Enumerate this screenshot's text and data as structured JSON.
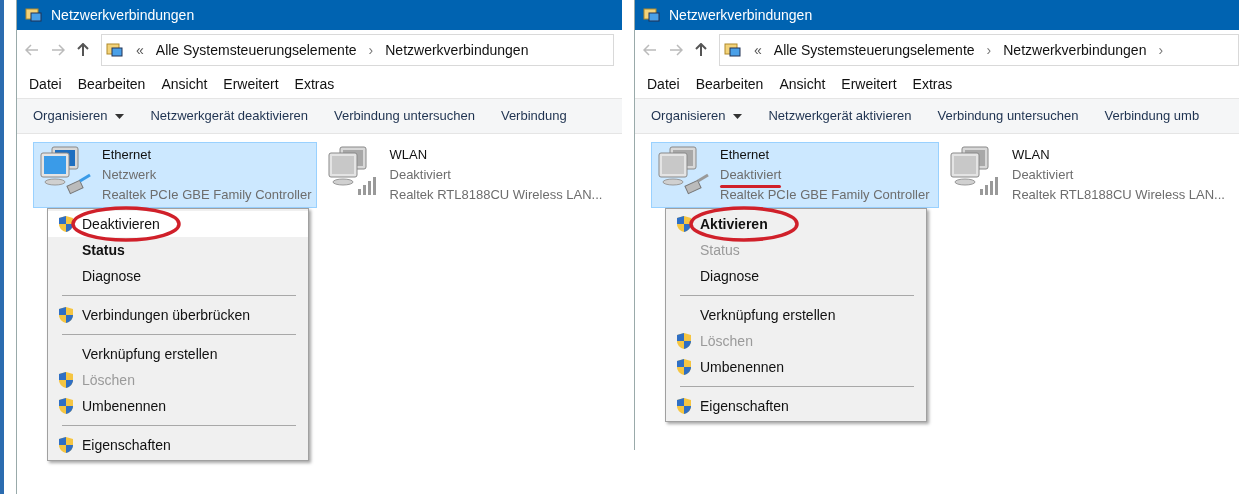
{
  "panels": [
    {
      "window": {
        "title": "Netzwerkverbindungen"
      },
      "address": {
        "back_mark": "«",
        "parts": [
          "Alle Systemsteuerungselemente",
          "Netzwerkverbindungen"
        ],
        "separator": "›",
        "trailing_separator": false
      },
      "menu_bar": [
        "Datei",
        "Bearbeiten",
        "Ansicht",
        "Erweitert",
        "Extras"
      ],
      "toolbar": [
        {
          "label": "Organisieren",
          "dropdown": true
        },
        {
          "label": "Netzwerkgerät deaktivieren",
          "dropdown": false
        },
        {
          "label": "Verbindung untersuchen",
          "dropdown": false
        },
        {
          "label": "Verbindung",
          "dropdown": false
        }
      ],
      "connections": [
        {
          "kind": "wired",
          "name": "Ethernet",
          "status": "Netzwerk",
          "device": "Realtek PCIe GBE Family Controller",
          "selected": true,
          "enabled": true,
          "underlined": false
        },
        {
          "kind": "wireless",
          "name": "WLAN",
          "status": "Deaktiviert",
          "device": "Realtek RTL8188CU Wireless LAN...",
          "selected": false,
          "enabled": false,
          "underlined": false
        }
      ],
      "context_menu": [
        {
          "kind": "item",
          "label": "Deaktivieren",
          "shield": true,
          "bold": false,
          "disabled": false,
          "selected": true,
          "circled": true
        },
        {
          "kind": "item",
          "label": "Status",
          "shield": false,
          "bold": true,
          "disabled": false,
          "selected": false,
          "circled": false
        },
        {
          "kind": "item",
          "label": "Diagnose",
          "shield": false,
          "bold": false,
          "disabled": false,
          "selected": false,
          "circled": false
        },
        {
          "kind": "separator"
        },
        {
          "kind": "item",
          "label": "Verbindungen überbrücken",
          "shield": true,
          "bold": false,
          "disabled": false,
          "selected": false,
          "circled": false
        },
        {
          "kind": "separator"
        },
        {
          "kind": "item",
          "label": "Verknüpfung erstellen",
          "shield": false,
          "bold": false,
          "disabled": false,
          "selected": false,
          "circled": false
        },
        {
          "kind": "item",
          "label": "Löschen",
          "shield": true,
          "bold": false,
          "disabled": true,
          "selected": false,
          "circled": false
        },
        {
          "kind": "item",
          "label": "Umbenennen",
          "shield": true,
          "bold": false,
          "disabled": false,
          "selected": false,
          "circled": false
        },
        {
          "kind": "separator"
        },
        {
          "kind": "item",
          "label": "Eigenschaften",
          "shield": true,
          "bold": false,
          "disabled": false,
          "selected": false,
          "circled": false
        }
      ]
    },
    {
      "window": {
        "title": "Netzwerkverbindungen"
      },
      "address": {
        "back_mark": "«",
        "parts": [
          "Alle Systemsteuerungselemente",
          "Netzwerkverbindungen"
        ],
        "separator": "›",
        "trailing_separator": true
      },
      "menu_bar": [
        "Datei",
        "Bearbeiten",
        "Ansicht",
        "Erweitert",
        "Extras"
      ],
      "toolbar": [
        {
          "label": "Organisieren",
          "dropdown": true
        },
        {
          "label": "Netzwerkgerät aktivieren",
          "dropdown": false
        },
        {
          "label": "Verbindung untersuchen",
          "dropdown": false
        },
        {
          "label": "Verbindung umb",
          "dropdown": false
        }
      ],
      "connections": [
        {
          "kind": "wired",
          "name": "Ethernet",
          "status": "Deaktiviert",
          "device": "Realtek PCIe GBE Family Controller",
          "selected": true,
          "enabled": false,
          "underlined": true
        },
        {
          "kind": "wireless",
          "name": "WLAN",
          "status": "Deaktiviert",
          "device": "Realtek RTL8188CU Wireless LAN...",
          "selected": false,
          "enabled": false,
          "underlined": false
        }
      ],
      "context_menu": [
        {
          "kind": "item",
          "label": "Aktivieren",
          "shield": true,
          "bold": true,
          "disabled": false,
          "selected": false,
          "circled": true
        },
        {
          "kind": "item",
          "label": "Status",
          "shield": false,
          "bold": false,
          "disabled": true,
          "selected": false,
          "circled": false
        },
        {
          "kind": "item",
          "label": "Diagnose",
          "shield": false,
          "bold": false,
          "disabled": false,
          "selected": false,
          "circled": false
        },
        {
          "kind": "separator"
        },
        {
          "kind": "item",
          "label": "Verknüpfung erstellen",
          "shield": false,
          "bold": false,
          "disabled": false,
          "selected": false,
          "circled": false
        },
        {
          "kind": "item",
          "label": "Löschen",
          "shield": true,
          "bold": false,
          "disabled": true,
          "selected": false,
          "circled": false
        },
        {
          "kind": "item",
          "label": "Umbenennen",
          "shield": true,
          "bold": false,
          "disabled": false,
          "selected": false,
          "circled": false
        },
        {
          "kind": "separator"
        },
        {
          "kind": "item",
          "label": "Eigenschaften",
          "shield": true,
          "bold": false,
          "disabled": false,
          "selected": false,
          "circled": false
        }
      ]
    }
  ]
}
